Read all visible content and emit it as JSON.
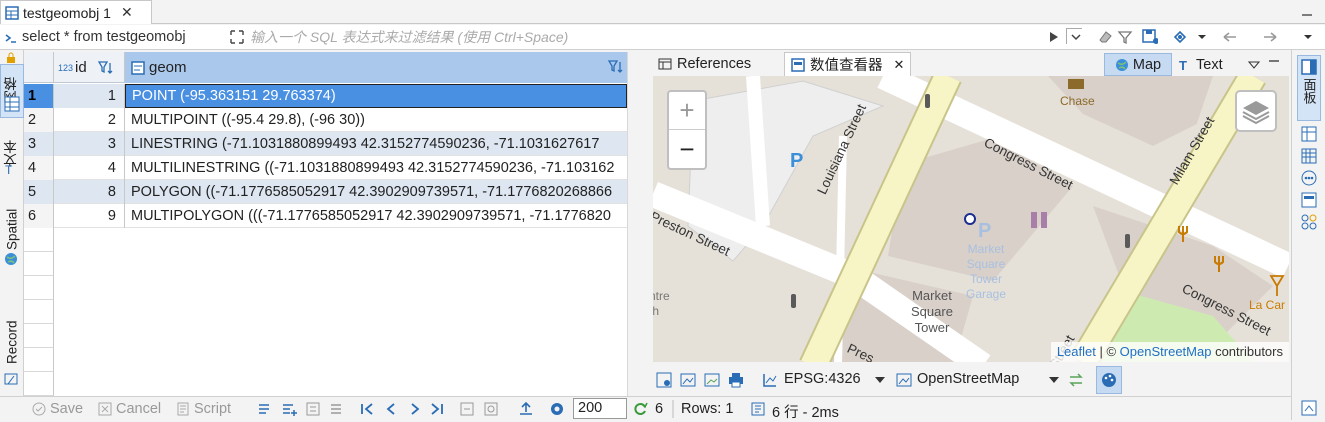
{
  "tab": {
    "title": "testgeomobj 1",
    "close": "✕"
  },
  "filter": {
    "query": "select * from testgeomobj",
    "placeholder": "输入一个 SQL 表达式来过滤结果 (使用 Ctrl+Space)"
  },
  "left_tabs": {
    "grid": "网格",
    "text": "文本",
    "spatial": "Spatial",
    "record": "Record"
  },
  "grid": {
    "columns": [
      {
        "type_badge": "123",
        "name": "id"
      },
      {
        "name": "geom"
      }
    ],
    "rows": [
      {
        "rownum": "1",
        "id": "1",
        "geom": "POINT (-95.363151 29.763374)"
      },
      {
        "rownum": "2",
        "id": "2",
        "geom": "MULTIPOINT ((-95.4 29.8), (-96 30))"
      },
      {
        "rownum": "3",
        "id": "3",
        "geom": "LINESTRING (-71.1031880899493 42.3152774590236, -71.1031627617"
      },
      {
        "rownum": "4",
        "id": "4",
        "geom": "MULTILINESTRING ((-71.1031880899493 42.3152774590236, -71.103162"
      },
      {
        "rownum": "5",
        "id": "8",
        "geom": "POLYGON ((-71.1776585052917 42.3902909739571, -71.1776820268866"
      },
      {
        "rownum": "6",
        "id": "9",
        "geom": "MULTIPOLYGON (((-71.1776585052917 42.3902909739571, -71.1776820"
      }
    ],
    "selected_row": 1
  },
  "right_panel": {
    "tabs": [
      {
        "label": "References"
      },
      {
        "label": "数值查看器",
        "close": "✕"
      }
    ],
    "mode_map": "Map",
    "mode_text": "Text"
  },
  "map": {
    "zoom_in": "+",
    "zoom_out": "−",
    "parking": "P",
    "labels": {
      "chase": "Chase",
      "preston": "Preston Street",
      "louisiana": "Louisiana Street",
      "congress": "Congress Street",
      "milam": "Milam Street",
      "congress2": "Congress Street",
      "market_square_tower": [
        "Market",
        "Square",
        "Tower"
      ],
      "garage": [
        "Market",
        "Square",
        "Tower",
        "Garage"
      ],
      "centre": [
        "ntre",
        "th"
      ],
      "la_car": "La Car",
      "pres2": "Pres",
      "street_bottom": "Street"
    },
    "attribution": {
      "leaflet": "Leaflet",
      "sep": " | © ",
      "osm": "OpenStreetMap",
      "suffix": " contributors"
    }
  },
  "map_toolbar": {
    "crs": "EPSG:4326",
    "tiles": "OpenStreetMap"
  },
  "statusbar": {
    "save": "Save",
    "cancel": "Cancel",
    "script": "Script",
    "fetch_size": "200",
    "refresh_count": "6",
    "rows": "Rows: 1",
    "summary": "6 行 - 2ms"
  },
  "right_side": {
    "panel": "面板"
  },
  "colors": {
    "selection": "#4a90e2",
    "header_geom": "#a9c8ec",
    "alt_row": "#dde6f1",
    "map_road": "#f7f4c5",
    "accent": "#1f6fc5"
  }
}
